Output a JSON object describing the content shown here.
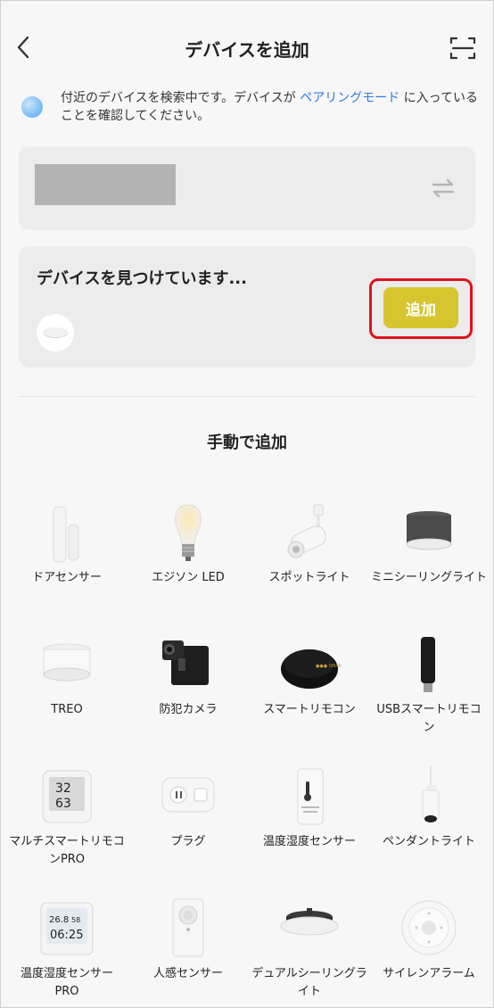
{
  "header": {
    "title": "デバイスを追加"
  },
  "notice": {
    "text_before": "付近のデバイスを検索中です。デバイスが",
    "link": "ペアリングモード",
    "text_after": "に入っていることを確認してください。"
  },
  "found": {
    "title": "デバイスを見つけています...",
    "add_label": "追加"
  },
  "manual": {
    "title": "手動で追加",
    "devices": [
      {
        "label": "ドアセンサー",
        "icon": "door-sensor"
      },
      {
        "label": "エジソン LED",
        "icon": "edison-bulb"
      },
      {
        "label": "スポットライト",
        "icon": "spotlight"
      },
      {
        "label": "ミニシーリングライト",
        "icon": "mini-ceiling-light"
      },
      {
        "label": "TREO",
        "icon": "treo-light"
      },
      {
        "label": "防犯カメラ",
        "icon": "security-camera"
      },
      {
        "label": "スマートリモコン",
        "icon": "smart-remote"
      },
      {
        "label": "USBスマートリモコン",
        "icon": "usb-remote"
      },
      {
        "label": "マルチスマートリモコンPRO",
        "icon": "multi-remote-pro"
      },
      {
        "label": "プラグ",
        "icon": "smart-plug"
      },
      {
        "label": "温度湿度センサー",
        "icon": "temp-humidity-sensor"
      },
      {
        "label": "ペンダントライト",
        "icon": "pendant-light"
      },
      {
        "label": "温度湿度センサーPRO",
        "icon": "temp-humidity-sensor-pro"
      },
      {
        "label": "人感センサー",
        "icon": "motion-sensor"
      },
      {
        "label": "デュアルシーリングライト",
        "icon": "dual-ceiling-light"
      },
      {
        "label": "サイレンアラーム",
        "icon": "siren-alarm"
      }
    ],
    "lcd_readings": [
      {
        "top": "32",
        "bottom": "63"
      },
      {
        "line1": "26.8",
        "line1b": "58",
        "line2": "06:25"
      }
    ]
  }
}
